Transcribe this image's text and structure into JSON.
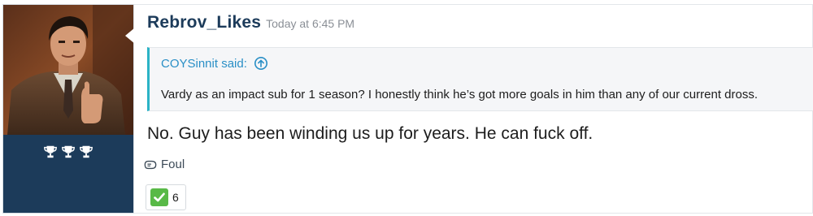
{
  "post": {
    "author": "Rebrov_Likes",
    "timestamp": "Today at 6:45 PM",
    "trophy_count": 3,
    "quote": {
      "attribution": "COYSinnit said:",
      "text": "Vardy as an impact sub for 1 season? I honestly think he’s got more goals in him than any of our current dross."
    },
    "message": "No. Guy has been winding us up for years. He can fuck off.",
    "report_label": "Foul",
    "reaction": {
      "emoji": "white-check-mark",
      "count": "6"
    }
  },
  "colors": {
    "sidebar": "#1c3b5a",
    "username": "#1c3b5a",
    "quote_accent": "#2bb3c6",
    "quote_author": "#2a8fc6",
    "check_green": "#58b947"
  },
  "icons": {
    "quote_link": "arrow-up-circle-icon",
    "report": "flag-icon",
    "trophy": "trophy-icon"
  }
}
